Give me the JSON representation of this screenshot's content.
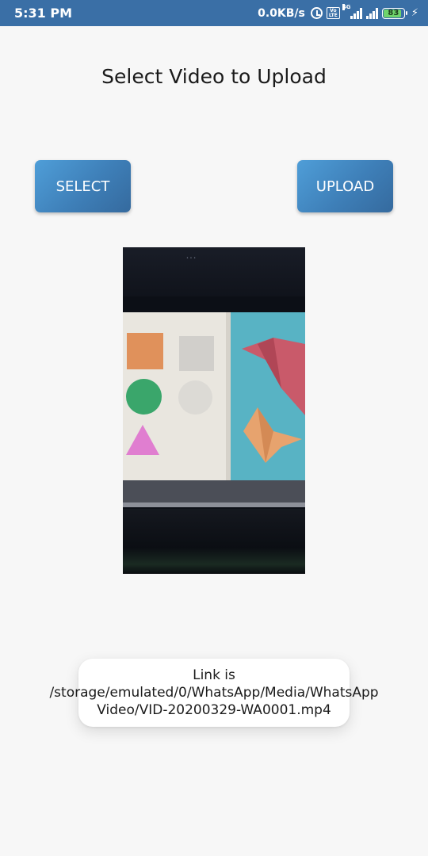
{
  "status_bar": {
    "time": "5:31 PM",
    "network_speed": "0.0KB/s",
    "network_type": "4G",
    "battery_level": "83",
    "volte_label": "Vo LTE"
  },
  "page": {
    "title": "Select Video to Upload"
  },
  "buttons": {
    "select_label": "SELECT",
    "upload_label": "UPLOAD"
  },
  "video_preview": {
    "label": "video-thumbnail"
  },
  "toast": {
    "message": "Link is /storage/emulated/0/WhatsApp/Media/WhatsApp Video/VID-20200329-WA0001.mp4"
  },
  "colors": {
    "status_bar": "#3a6fa6",
    "button_gradient_start": "#4f9ed8",
    "button_gradient_end": "#356a9e",
    "background": "#f7f7f7",
    "battery_fill": "#6ed36b"
  }
}
